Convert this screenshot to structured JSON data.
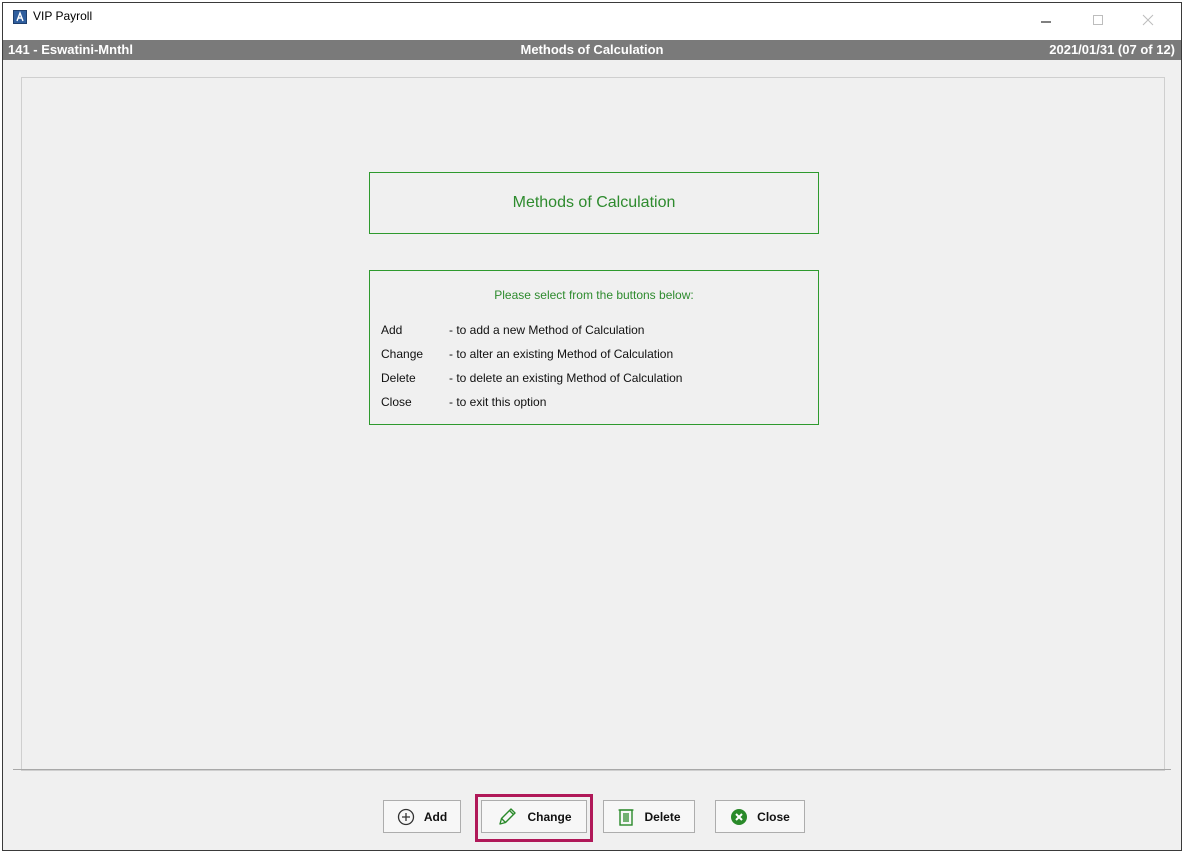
{
  "window": {
    "app_title": "VIP Payroll",
    "icon": "app-logo-icon",
    "controls": [
      "minimize-icon",
      "maximize-icon",
      "close-icon"
    ]
  },
  "status_bar": {
    "company": "141 - Eswatini-Mnthl",
    "screen_title": "Methods of Calculation",
    "period": "2021/01/31 (07 of 12)"
  },
  "main": {
    "title": "Methods of Calculation",
    "instructions_header": "Please select from the buttons below:",
    "options": [
      {
        "key": "Add",
        "description": "- to add a new Method of Calculation"
      },
      {
        "key": "Change",
        "description": "- to alter an existing Method of Calculation"
      },
      {
        "key": "Delete",
        "description": "- to delete an existing Method of Calculation"
      },
      {
        "key": "Close",
        "description": "- to exit this option"
      }
    ]
  },
  "buttons": {
    "add": {
      "label": "Add",
      "icon": "plus-circle-icon"
    },
    "change": {
      "label": "Change",
      "icon": "pencil-icon",
      "highlighted": true
    },
    "delete": {
      "label": "Delete",
      "icon": "trash-icon"
    },
    "close": {
      "label": "Close",
      "icon": "close-circle-icon"
    }
  },
  "colors": {
    "accent_green": "#2e8b2e",
    "status_bar": "#7a7a7a",
    "highlight": "#b01858"
  }
}
